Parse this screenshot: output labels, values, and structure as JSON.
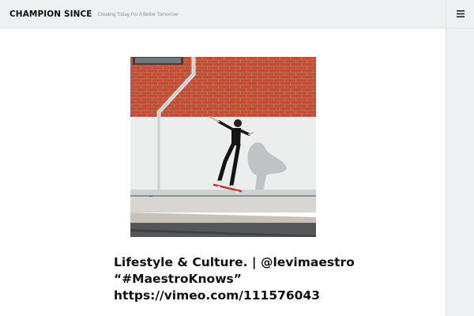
{
  "header": {
    "site_title": "CHAMPION SINCE",
    "tagline": "Creating Today For A Better Tomorrow"
  },
  "sidebar": {
    "menu_icon": "hamburger-menu-icon"
  },
  "post": {
    "image_subject": "skateboarder-grinding-rail-photo",
    "title_lines": [
      "Lifestyle & Culture. | @levimaestro",
      "“#MaestroKnows”",
      "https://vimeo.com/111576043"
    ]
  },
  "colors": {
    "header_bg": "#eef1f2",
    "brick": "#c9472e",
    "text": "#111111"
  }
}
